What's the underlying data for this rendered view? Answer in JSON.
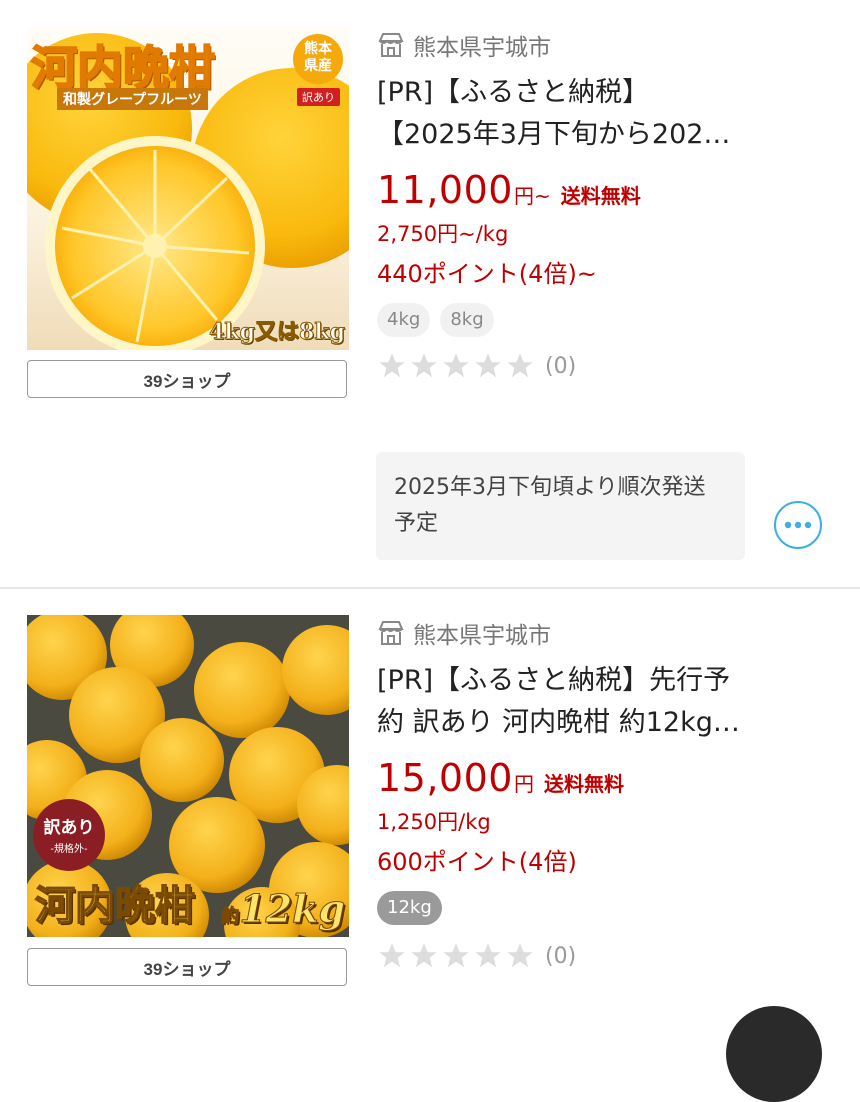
{
  "items": [
    {
      "location": "熊本県宇城市",
      "location_icon": "shop-icon",
      "title_line1": "[PR]【ふるさと納税】",
      "title_line2": "【2025年3月下旬から202…",
      "price": "11,000",
      "price_unit": "円~",
      "shipping": "送料無料",
      "per_kg": "2,750円~/kg",
      "points": "440ポイント(4倍)~",
      "tags": [
        "4kg",
        "8kg"
      ],
      "rating": 0,
      "review_count": "(0)",
      "note": "2025年3月下旬頃より順次発送予定",
      "shop_button": "39ショップ",
      "image": {
        "title": "河内晩柑",
        "subtitle": "和製グレープフルーツ",
        "badge_top": "熊本",
        "badge_bottom": "県産",
        "badge_tag": "訳あり",
        "weight": "4kg又は8kg"
      }
    },
    {
      "location": "熊本県宇城市",
      "location_icon": "shop-icon",
      "title_line1": "[PR]【ふるさと納税】先行予",
      "title_line2": "約 訳あり 河内晩柑 約12kg…",
      "price": "15,000",
      "price_unit": "円",
      "shipping": "送料無料",
      "per_kg": "1,250円/kg",
      "points": "600ポイント(4倍)",
      "tags": [
        "12kg"
      ],
      "rating": 0,
      "review_count": "(0)",
      "shop_button": "39ショップ",
      "image": {
        "title": "河内晩柑",
        "badge_main": "訳あり",
        "badge_sub": "-規格外-",
        "weight_prefix": "約",
        "weight": "12kg"
      }
    }
  ],
  "colors": {
    "price_red": "#bf0000",
    "accent_blue": "#3cb0e0",
    "orange": "#f6b21a"
  }
}
